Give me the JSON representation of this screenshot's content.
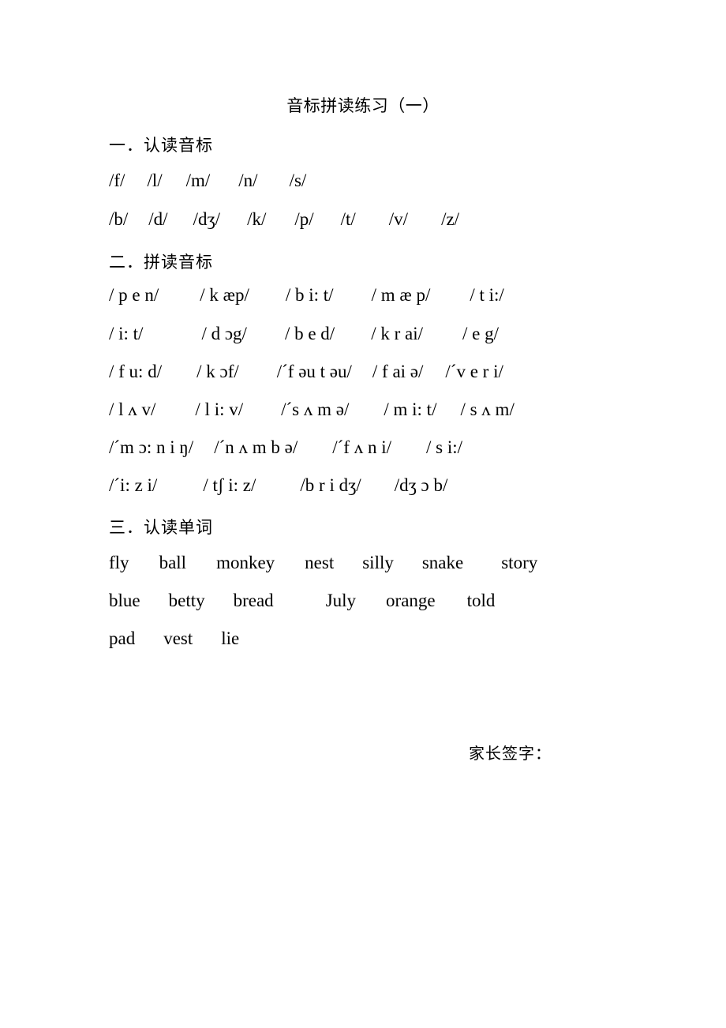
{
  "document": {
    "title": "音标拼读练习（一）",
    "signature_label": "家长签字："
  },
  "sections": [
    {
      "heading": "一．认读音标",
      "rows": [
        {
          "items": [
            "/f/",
            "/l/",
            "/m/",
            "/n/",
            "/s/"
          ],
          "gaps": [
            0,
            28,
            30,
            36,
            40
          ]
        },
        {
          "items": [
            "/b/",
            "/d/",
            "/dʒ/",
            "/k/",
            "/p/",
            "/t/",
            "/v/",
            "/z/"
          ],
          "gaps": [
            0,
            26,
            32,
            34,
            36,
            34,
            42,
            42
          ]
        }
      ]
    },
    {
      "heading": "二．拼读音标",
      "rows": [
        {
          "items": [
            "/ p e n/",
            "/ k æp/",
            "/ b i: t/",
            "/ m æ p/",
            "/ t i:/"
          ],
          "gaps": [
            0,
            52,
            46,
            48,
            50
          ]
        },
        {
          "items": [
            "/ i: t/",
            "/ d ɔg/",
            "/ b e d/",
            "/ k r ai/",
            "/ e g/"
          ],
          "gaps": [
            0,
            74,
            48,
            46,
            50
          ]
        },
        {
          "items": [
            "/ f u: d/",
            "/ k ɔf/",
            "/ˊf əu t əu/",
            "/ f ai ə/",
            "/ˊv e r i/"
          ],
          "gaps": [
            0,
            44,
            48,
            26,
            28
          ]
        },
        {
          "items": [
            "/ l ʌ v/",
            "/ l i: v/",
            "/ˊs ʌ m ə/",
            "/ m i: t/",
            "/ s ʌ m/"
          ],
          "gaps": [
            0,
            50,
            48,
            44,
            30
          ]
        },
        {
          "items": [
            "/ˊm ɔ: n i ŋ/",
            "/ˊn ʌ m b ə/",
            "/ˊf ʌ n i/",
            "/ s i:/"
          ],
          "gaps": [
            0,
            26,
            44,
            44
          ]
        },
        {
          "items": [
            "/ˊi: z i/",
            "/ tʃ i: z/",
            "/b r i dʒ/",
            "/dʒ ɔ b/"
          ],
          "gaps": [
            0,
            58,
            56,
            42
          ]
        }
      ]
    },
    {
      "heading": "三．认读单词",
      "rows": [
        {
          "items": [
            "fly",
            "ball",
            "monkey",
            "nest",
            "silly",
            "snake",
            "story"
          ],
          "gaps": [
            0,
            38,
            38,
            38,
            36,
            36,
            48
          ]
        },
        {
          "items": [
            "blue",
            "betty",
            "bread",
            "July",
            "orange",
            "told"
          ],
          "gaps": [
            0,
            36,
            36,
            66,
            38,
            40
          ]
        },
        {
          "items": [
            "pad",
            "vest",
            "lie"
          ],
          "gaps": [
            0,
            36,
            36
          ]
        }
      ]
    }
  ]
}
